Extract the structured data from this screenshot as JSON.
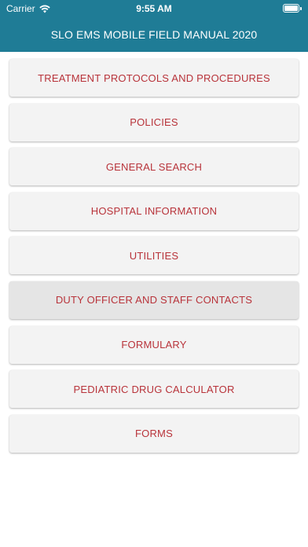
{
  "status_bar": {
    "carrier": "Carrier",
    "time": "9:55 AM",
    "battery_level": 1.0
  },
  "header": {
    "title": "SLO EMS MOBILE FIELD MANUAL 2020"
  },
  "menu": {
    "items": [
      {
        "label": "TREATMENT PROTOCOLS AND PROCEDURES"
      },
      {
        "label": "POLICIES"
      },
      {
        "label": "GENERAL SEARCH"
      },
      {
        "label": "HOSPITAL INFORMATION"
      },
      {
        "label": "UTILITIES"
      },
      {
        "label": "DUTY OFFICER AND STAFF CONTACTS",
        "pressed": true
      },
      {
        "label": "FORMULARY"
      },
      {
        "label": "PEDIATRIC DRUG CALCULATOR"
      },
      {
        "label": "FORMS"
      }
    ]
  },
  "colors": {
    "header_bg": "#1f7c96",
    "button_text": "#b8333a",
    "button_bg": "#f3f3f3"
  }
}
